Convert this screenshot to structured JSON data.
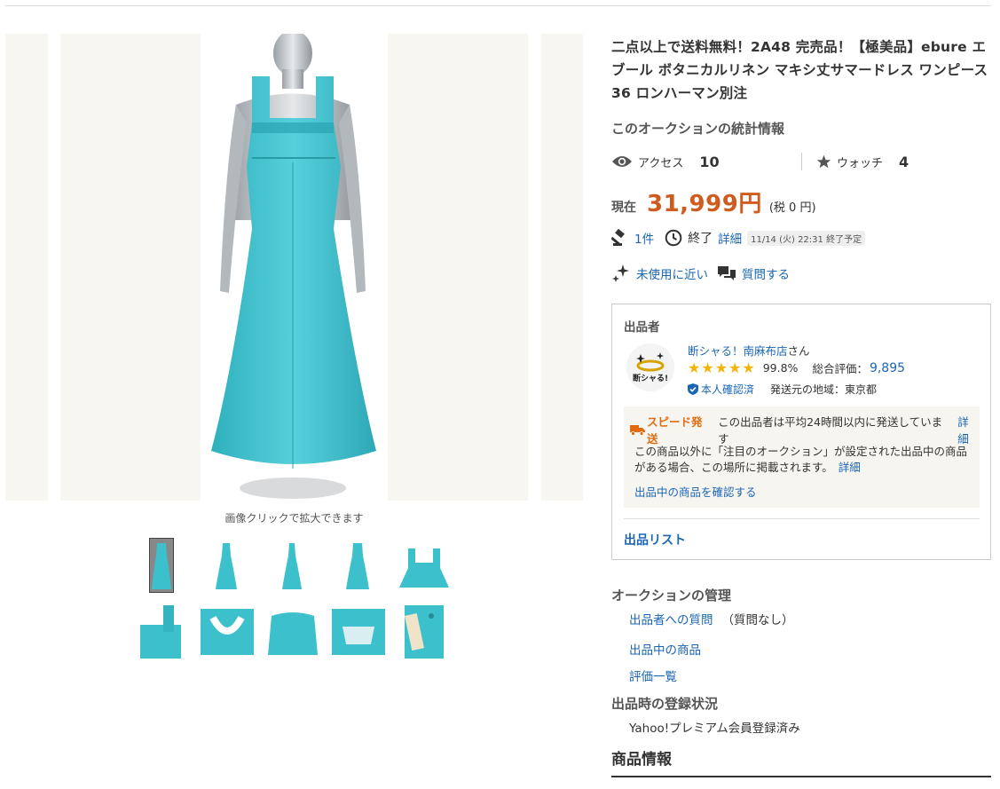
{
  "gallery": {
    "caption": "画像クリックで拡大できます",
    "thumbnail_count": 10
  },
  "listing": {
    "title": "二点以上で送料無料！2A48 完売品！【極美品】ebure エブール ボタニカルリネン マキシ丈サマードレス ワンピース 36 ロンハーマン別注"
  },
  "stats": {
    "heading": "このオークションの統計情報",
    "access_label": "アクセス",
    "access_value": "10",
    "watch_label": "ウォッチ",
    "watch_value": "4"
  },
  "price": {
    "label": "現在",
    "value": "31,999円",
    "tax": "(税 0 円)"
  },
  "meta": {
    "bids": "1件",
    "end_label": "終了",
    "detail_link": "詳細",
    "end_date": "11/14 (火) 22:31 終了予定"
  },
  "condition": {
    "label": "未使用に近い",
    "question_link": "質問する"
  },
  "seller": {
    "heading": "出品者",
    "name": "断シャる！南麻布店",
    "suffix": "さん",
    "stars": "★★★★★",
    "rating_pct": "99.8%",
    "total_label": "総合評価：",
    "total_value": "9,895",
    "verified": "本人確認済",
    "region": "発送元の地域：東京都",
    "avatar_text": "断シャる!",
    "speed_label": "スピード発送",
    "speed_text": "この出品者は平均24時間以内に発送しています",
    "speed_link": "詳細",
    "notice_text": "この商品以外に「注目のオークション」が設定された出品中の商品がある場合、この場所に掲載されます。",
    "notice_link": "詳細",
    "listing_link": "出品中の商品を確認する",
    "list_link": "出品リスト"
  },
  "management": {
    "heading": "オークションの管理",
    "question_link": "出品者への質問",
    "question_note": "（質問なし）",
    "items_link": "出品中の商品",
    "reviews_link": "評価一覧",
    "reg_heading": "出品時の登録状況",
    "reg_value": "Yahoo!プレミアム会員登録済み",
    "info_heading": "商品情報"
  },
  "colors": {
    "price": "#d05b1f",
    "link": "#1a66b5",
    "star": "#f5b400",
    "speed": "#e26b10",
    "dress": "#3cc0cc"
  },
  "icons": [
    "eye-icon",
    "star-icon",
    "gavel-icon",
    "clock-icon",
    "sparkle-icon",
    "chat-icon",
    "verified-icon",
    "truck-icon"
  ]
}
